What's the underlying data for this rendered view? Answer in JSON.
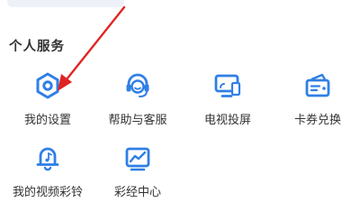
{
  "section": {
    "title": "个人服务"
  },
  "services": [
    {
      "label": "我的设置",
      "icon": "hexagon-gear-icon"
    },
    {
      "label": "帮助与客服",
      "icon": "headset-icon"
    },
    {
      "label": "电视投屏",
      "icon": "tv-cast-icon"
    },
    {
      "label": "卡券兑换",
      "icon": "coupon-wallet-icon"
    },
    {
      "label": "我的视频彩铃",
      "icon": "bell-music-icon"
    },
    {
      "label": "彩经中心",
      "icon": "trend-chart-icon"
    }
  ],
  "colors": {
    "accent": "#2f7fe6",
    "annotation": "#e02424"
  }
}
